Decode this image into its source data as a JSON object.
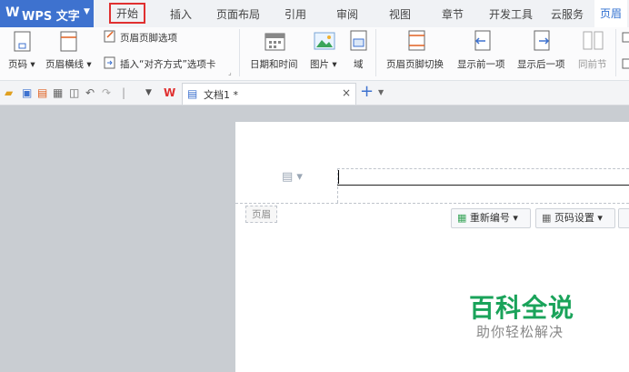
{
  "app": {
    "title": "WPS 文字"
  },
  "menu": {
    "tabs": [
      "开始",
      "插入",
      "页面布局",
      "引用",
      "审阅",
      "视图",
      "章节",
      "开发工具",
      "云服务",
      "页眉"
    ]
  },
  "ribbon": {
    "page_number": "页码",
    "header_line": "页眉横线",
    "header_footer_options": "页眉页脚选项",
    "insert_align_tab": "插入“对齐方式”选项卡",
    "date_time": "日期和时间",
    "picture": "图片",
    "field": "域",
    "switch_header_footer": "页眉页脚切换",
    "show_previous": "显示前一项",
    "show_next": "显示后一项",
    "same_as_previous": "同前节"
  },
  "doc": {
    "tab_title": "文档1 *"
  },
  "header_area": {
    "label": "页眉",
    "renumber": "重新编号",
    "page_number_settings": "页码设置"
  },
  "watermark": {
    "line1": "百科全说",
    "line2": "助你轻松解决"
  },
  "colors": {
    "accent": "#3e72cf",
    "watermark": "#1aa35a",
    "highlight": "#e03030"
  }
}
